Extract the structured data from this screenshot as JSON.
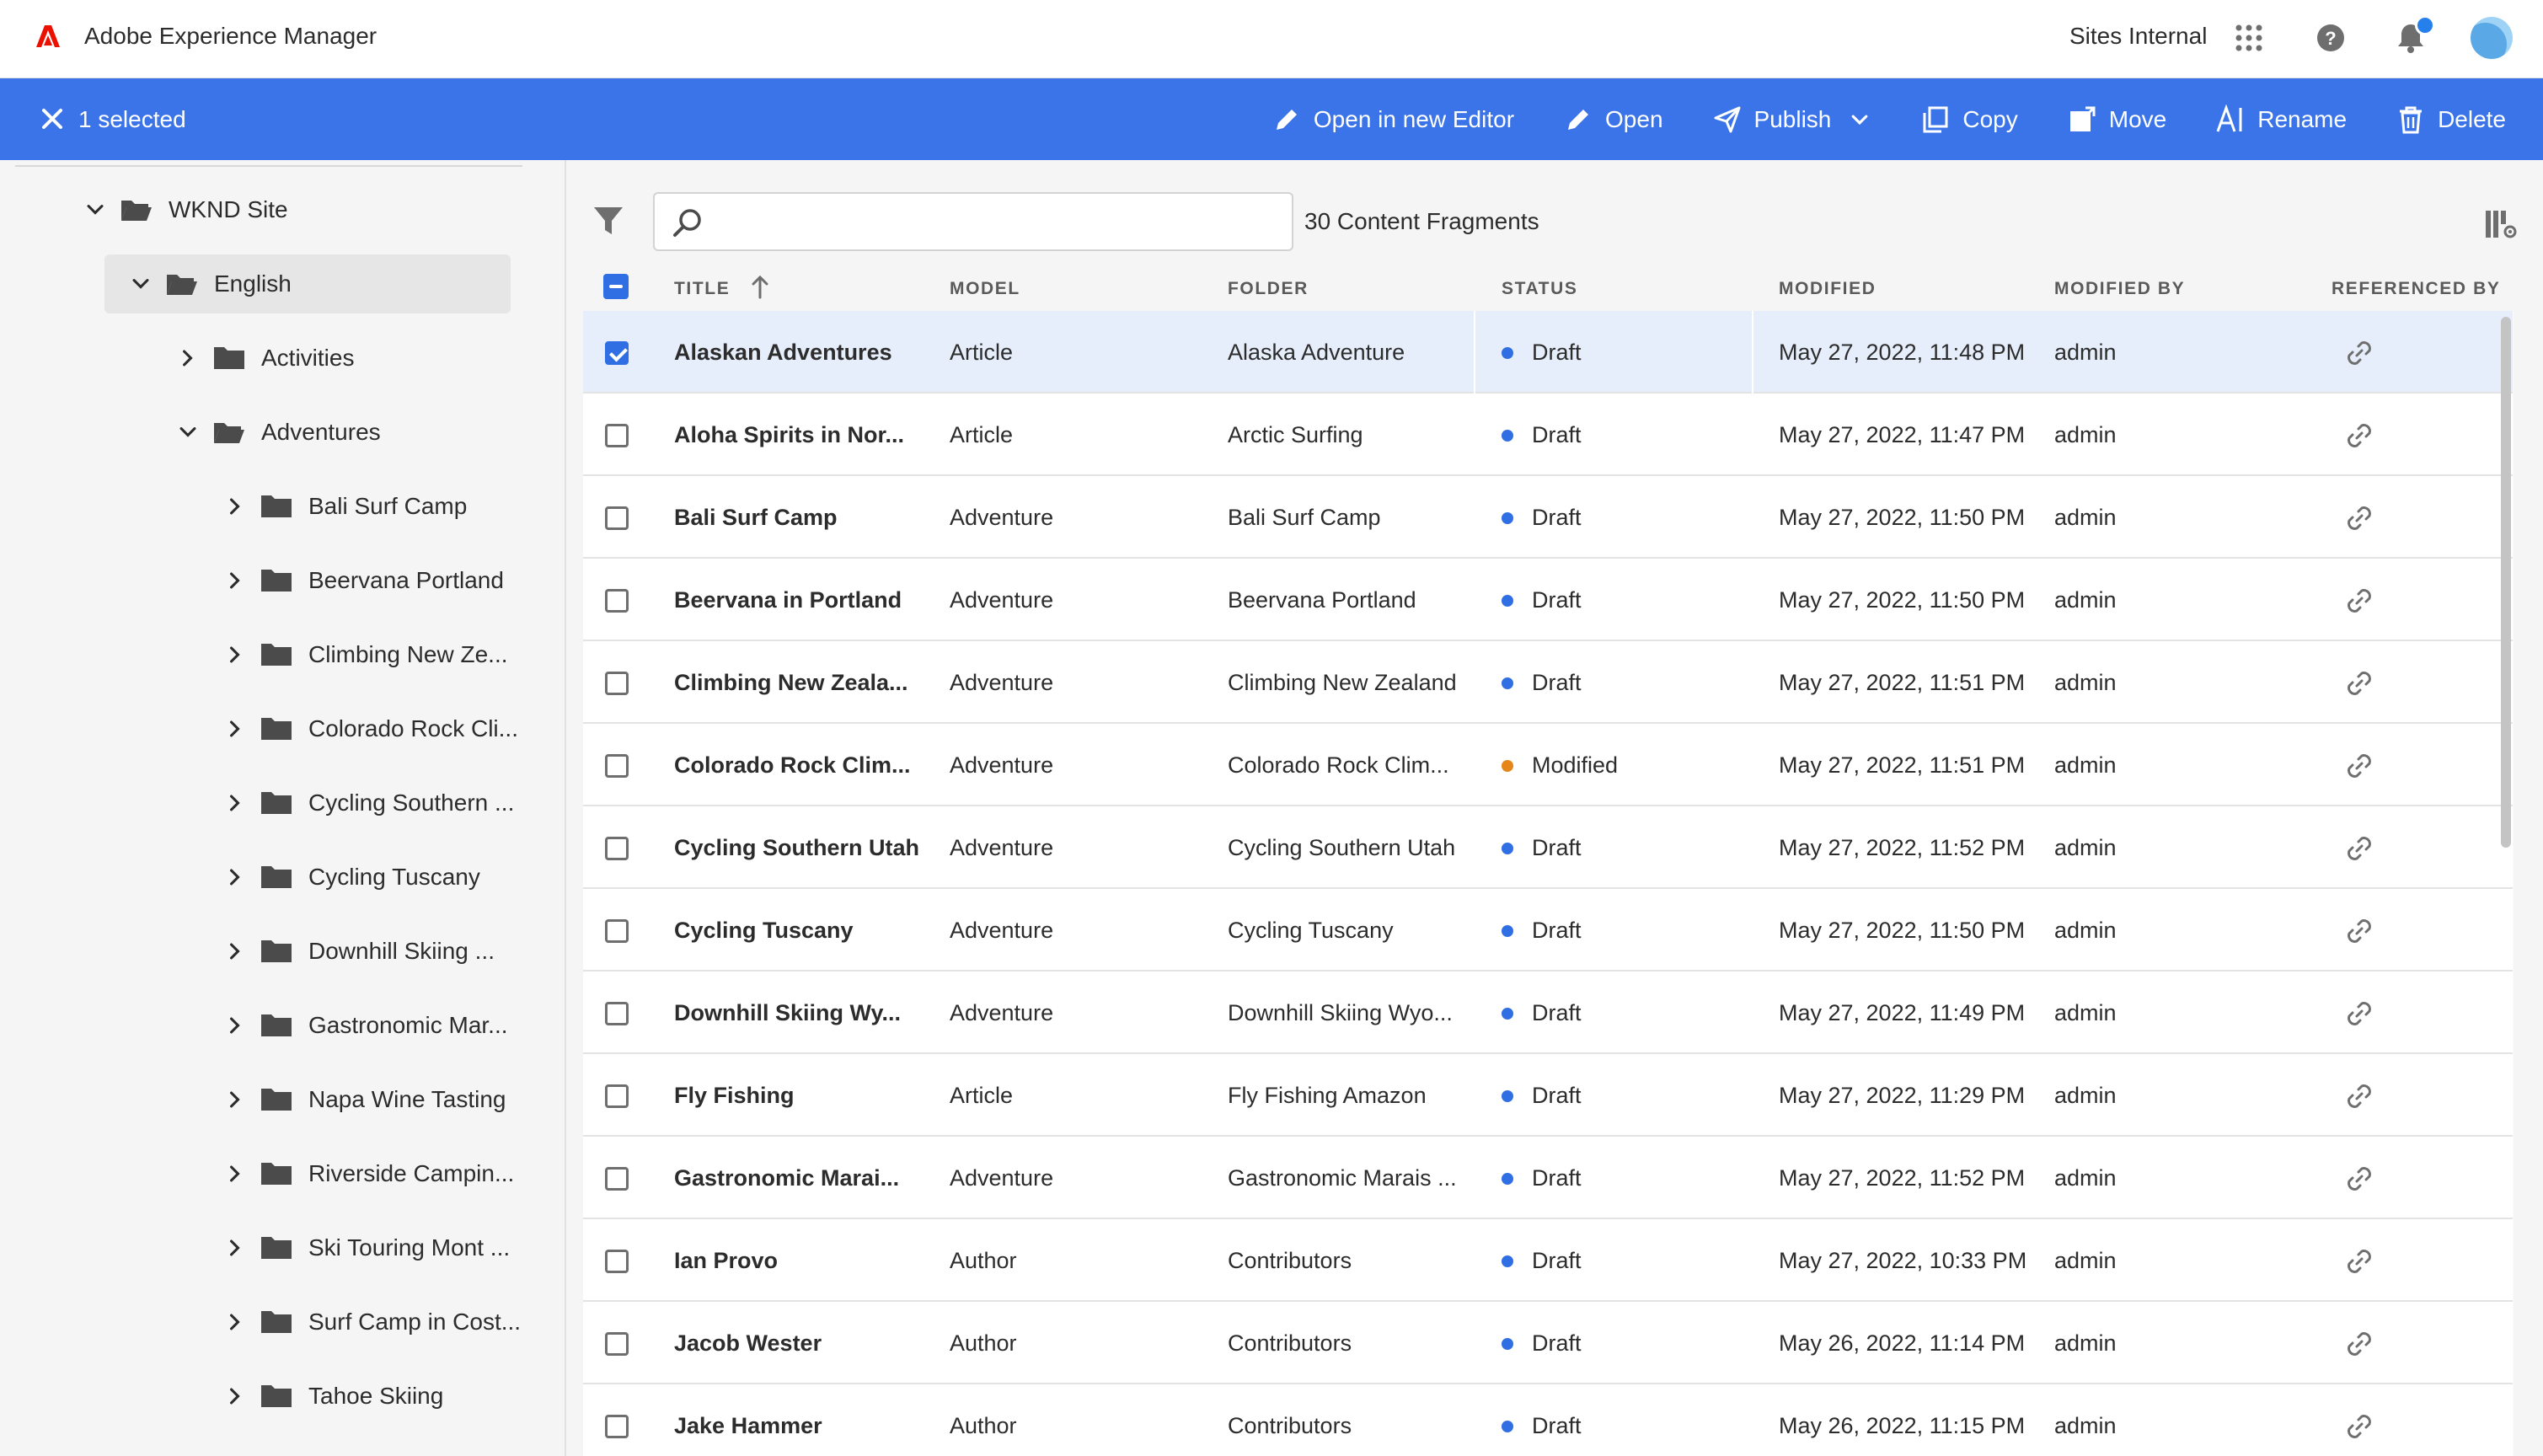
{
  "header": {
    "app_title": "Adobe Experience Manager",
    "environment": "Sites Internal",
    "icons": [
      "apps-grid-icon",
      "help-icon",
      "bell-icon",
      "avatar"
    ]
  },
  "action_bar": {
    "selected_count": "1 selected",
    "actions": {
      "open_new_editor": "Open in new Editor",
      "open": "Open",
      "publish": "Publish",
      "copy": "Copy",
      "move": "Move",
      "rename": "Rename",
      "delete": "Delete"
    },
    "color": "#3b74e8"
  },
  "sidebar": {
    "root": "WKND Site",
    "language": "English",
    "level1": [
      "Activities",
      "Adventures"
    ],
    "adventures_children": [
      "Bali Surf Camp",
      "Beervana Portland",
      "Climbing New Ze...",
      "Colorado Rock Cli...",
      "Cycling Southern ...",
      "Cycling Tuscany",
      "Downhill Skiing ...",
      "Gastronomic Mar...",
      "Napa Wine Tasting",
      "Riverside Campin...",
      "Ski Touring Mont ...",
      "Surf Camp in Cost...",
      "Tahoe Skiing"
    ]
  },
  "toolbar": {
    "search_placeholder": "",
    "count_label": "30 Content Fragments"
  },
  "table": {
    "columns": {
      "title": "TITLE",
      "model": "MODEL",
      "folder": "FOLDER",
      "status": "STATUS",
      "modified": "MODIFIED",
      "modified_by": "MODIFIED BY",
      "referenced_by": "REFERENCED BY"
    },
    "status_colors": {
      "Draft": "#2f6ee3",
      "Modified": "#e68619"
    },
    "rows": [
      {
        "title": "Alaskan Adventures",
        "model": "Article",
        "folder": "Alaska Adventure",
        "status": "Draft",
        "modified": "May 27, 2022, 11:48 PM",
        "by": "admin",
        "selected": true
      },
      {
        "title": "Aloha Spirits in Nor...",
        "model": "Article",
        "folder": "Arctic Surfing",
        "status": "Draft",
        "modified": "May 27, 2022, 11:47 PM",
        "by": "admin"
      },
      {
        "title": "Bali Surf Camp",
        "model": "Adventure",
        "folder": "Bali Surf Camp",
        "status": "Draft",
        "modified": "May 27, 2022, 11:50 PM",
        "by": "admin"
      },
      {
        "title": "Beervana in Portland",
        "model": "Adventure",
        "folder": "Beervana Portland",
        "status": "Draft",
        "modified": "May 27, 2022, 11:50 PM",
        "by": "admin"
      },
      {
        "title": "Climbing New Zeala...",
        "model": "Adventure",
        "folder": "Climbing New Zealand",
        "status": "Draft",
        "modified": "May 27, 2022, 11:51 PM",
        "by": "admin"
      },
      {
        "title": "Colorado Rock Clim...",
        "model": "Adventure",
        "folder": "Colorado Rock Clim...",
        "status": "Modified",
        "modified": "May 27, 2022, 11:51 PM",
        "by": "admin"
      },
      {
        "title": "Cycling Southern Utah",
        "model": "Adventure",
        "folder": "Cycling Southern Utah",
        "status": "Draft",
        "modified": "May 27, 2022, 11:52 PM",
        "by": "admin"
      },
      {
        "title": "Cycling Tuscany",
        "model": "Adventure",
        "folder": "Cycling Tuscany",
        "status": "Draft",
        "modified": "May 27, 2022, 11:50 PM",
        "by": "admin"
      },
      {
        "title": "Downhill Skiing Wy...",
        "model": "Adventure",
        "folder": "Downhill Skiing Wyo...",
        "status": "Draft",
        "modified": "May 27, 2022, 11:49 PM",
        "by": "admin"
      },
      {
        "title": "Fly Fishing",
        "model": "Article",
        "folder": "Fly Fishing Amazon",
        "status": "Draft",
        "modified": "May 27, 2022, 11:29 PM",
        "by": "admin"
      },
      {
        "title": "Gastronomic Marai...",
        "model": "Adventure",
        "folder": "Gastronomic Marais ...",
        "status": "Draft",
        "modified": "May 27, 2022, 11:52 PM",
        "by": "admin"
      },
      {
        "title": "Ian Provo",
        "model": "Author",
        "folder": "Contributors",
        "status": "Draft",
        "modified": "May 27, 2022, 10:33 PM",
        "by": "admin"
      },
      {
        "title": "Jacob Wester",
        "model": "Author",
        "folder": "Contributors",
        "status": "Draft",
        "modified": "May 26, 2022, 11:14 PM",
        "by": "admin"
      },
      {
        "title": "Jake Hammer",
        "model": "Author",
        "folder": "Contributors",
        "status": "Draft",
        "modified": "May 26, 2022, 11:15 PM",
        "by": "admin"
      }
    ]
  }
}
